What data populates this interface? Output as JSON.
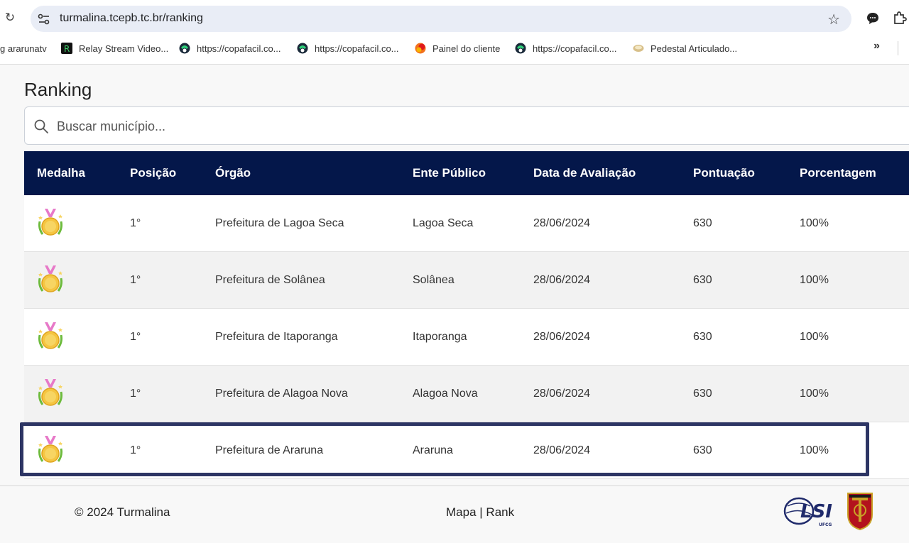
{
  "browser": {
    "url": "turmalina.tcepb.tc.br/ranking",
    "bookmarks": [
      {
        "label": "g ararunatv",
        "icon": "none"
      },
      {
        "label": "Relay Stream Video...",
        "icon": "relay-icon"
      },
      {
        "label": "https://copafacil.co...",
        "icon": "copafacil-icon"
      },
      {
        "label": "https://copafacil.co...",
        "icon": "copafacil-icon"
      },
      {
        "label": "Painel do cliente",
        "icon": "painel-icon"
      },
      {
        "label": "https://copafacil.co...",
        "icon": "copafacil-icon"
      },
      {
        "label": "Pedestal Articulado...",
        "icon": "pedestal-icon"
      }
    ],
    "more_bookmarks": "»"
  },
  "page": {
    "title": "Ranking",
    "search_placeholder": "Buscar município..."
  },
  "table": {
    "headers": [
      "Medalha",
      "Posição",
      "Órgão",
      "Ente Público",
      "Data de Avaliação",
      "Pontuação",
      "Porcentagem"
    ],
    "rows": [
      {
        "position": "1°",
        "orgao": "Prefeitura de Lagoa Seca",
        "ente": "Lagoa Seca",
        "date": "28/06/2024",
        "score": "630",
        "percent": "100%"
      },
      {
        "position": "1°",
        "orgao": "Prefeitura de Solânea",
        "ente": "Solânea",
        "date": "28/06/2024",
        "score": "630",
        "percent": "100%"
      },
      {
        "position": "1°",
        "orgao": "Prefeitura de Itaporanga",
        "ente": "Itaporanga",
        "date": "28/06/2024",
        "score": "630",
        "percent": "100%"
      },
      {
        "position": "1°",
        "orgao": "Prefeitura de Alagoa Nova",
        "ente": "Alagoa Nova",
        "date": "28/06/2024",
        "score": "630",
        "percent": "100%"
      },
      {
        "position": "1°",
        "orgao": "Prefeitura de Araruna",
        "ente": "Araruna",
        "date": "28/06/2024",
        "score": "630",
        "percent": "100%"
      }
    ],
    "highlighted_row": 4
  },
  "footer": {
    "copyright": "© 2024 Turmalina",
    "link_map": "Mapa",
    "separator": "|",
    "link_rank": "Rank",
    "lsi_logo_text": "LSI",
    "lsi_logo_sub": "UFCG"
  },
  "colors": {
    "header_bg": "#04174a",
    "highlight_border": "#2d3564",
    "medal_gold": "#f5c542",
    "medal_ribbon": "#e779c8"
  }
}
